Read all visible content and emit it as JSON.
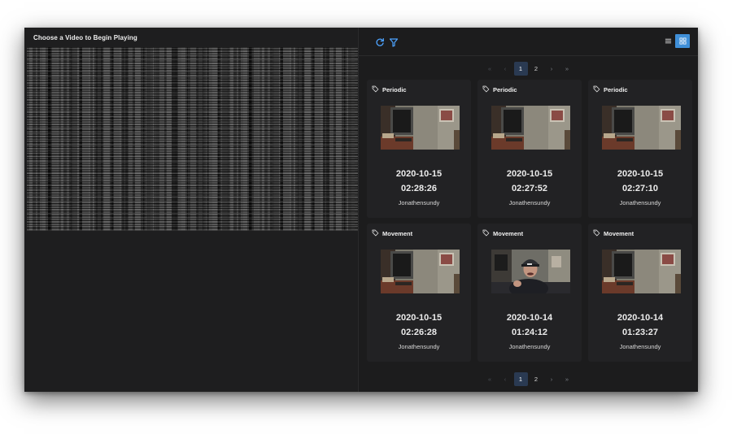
{
  "player": {
    "title": "Choose a Video to Begin Playing"
  },
  "toolbar": {
    "refresh_icon": "refresh-icon",
    "filter_icon": "filter-icon",
    "view_modes": [
      "list",
      "grid"
    ],
    "active_view": "grid",
    "accent_color": "#4da3ff"
  },
  "pagination": {
    "first": "«",
    "prev": "‹",
    "pages": [
      "1",
      "2"
    ],
    "current": "1",
    "next": "›",
    "last": "»"
  },
  "cards": [
    {
      "tag": "Periodic",
      "date": "2020-10-15",
      "time": "02:28:26",
      "user": "Jonathensundy",
      "thumb": "room"
    },
    {
      "tag": "Periodic",
      "date": "2020-10-15",
      "time": "02:27:52",
      "user": "Jonathensundy",
      "thumb": "room"
    },
    {
      "tag": "Periodic",
      "date": "2020-10-15",
      "time": "02:27:10",
      "user": "Jonathensundy",
      "thumb": "room"
    },
    {
      "tag": "Movement",
      "date": "2020-10-15",
      "time": "02:26:28",
      "user": "Jonathensundy",
      "thumb": "room"
    },
    {
      "tag": "Movement",
      "date": "2020-10-14",
      "time": "01:24:12",
      "user": "Jonathensundy",
      "thumb": "person"
    },
    {
      "tag": "Movement",
      "date": "2020-10-14",
      "time": "01:23:27",
      "user": "Jonathensundy",
      "thumb": "room"
    }
  ]
}
